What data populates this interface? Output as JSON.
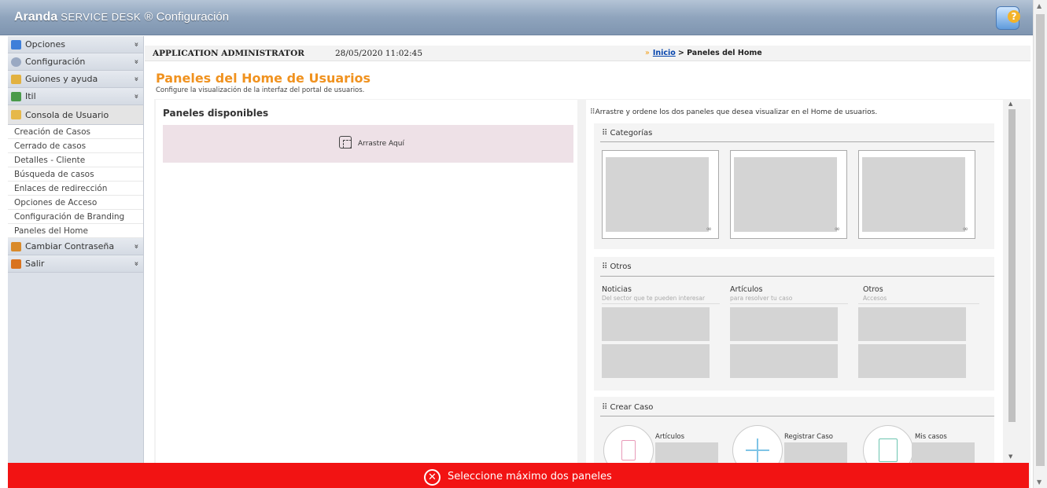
{
  "app": {
    "brand_name": "Aranda",
    "brand_product": "SERVICE DESK",
    "brand_mark": "®",
    "brand_section": "Configuración",
    "help_glyph": "?"
  },
  "sidebar": {
    "items": [
      {
        "label": "Opciones",
        "icon": "panel-icon",
        "color": "#3f7fd9",
        "chev": "»"
      },
      {
        "label": "Configuración",
        "icon": "gear-icon",
        "color": "#9aa9c2",
        "chev": "»"
      },
      {
        "label": "Guiones y ayuda",
        "icon": "script-icon",
        "color": "#e2b140",
        "chev": "»"
      },
      {
        "label": "Itil",
        "icon": "chart-icon",
        "color": "#4a9a4a",
        "chev": "»"
      },
      {
        "label": "Consola de Usuario",
        "icon": "folder-icon",
        "color": "#e6b84a"
      },
      {
        "label": "Cambiar Contraseña",
        "icon": "key-user-icon",
        "color": "#d98a2a",
        "chev": "»"
      },
      {
        "label": "Salir",
        "icon": "exit-user-icon",
        "color": "#d9731f",
        "chev": "»"
      }
    ],
    "subitems": [
      "Creación de Casos",
      "Cerrado de casos",
      "Detalles - Cliente",
      "Búsqueda de casos",
      "Enlaces de redirección",
      "Opciones de Acceso",
      "Configuración de Branding",
      "Paneles del Home"
    ]
  },
  "header": {
    "user": "APPLICATION ADMINISTRATOR",
    "datetime": "28/05/2020 11:02:45",
    "crumb_arrow": "»",
    "crumb_home": "Inicio",
    "crumb_current": "> Paneles del Home"
  },
  "page": {
    "title": "Paneles del Home de Usuarios",
    "subtitle": "Configure la visualización de la interfaz del portal de usuarios."
  },
  "available": {
    "title": "Paneles disponibles",
    "drop_label": "Arrastre Aquí"
  },
  "preview": {
    "hint": "Arrastre y ordene los dos paneles que desea visualizar en el Home de usuarios.",
    "grip": "⠿",
    "link_glyph": "∞",
    "categorias": {
      "title": "Categorías"
    },
    "otros": {
      "title": "Otros",
      "columns": [
        {
          "head": "Noticias",
          "sub": "Del sector que te pueden interesar"
        },
        {
          "head": "Artículos",
          "sub": "para resolver tu caso"
        },
        {
          "head": "Otros",
          "sub": "Accesos"
        }
      ]
    },
    "crear": {
      "title": "Crear Caso",
      "items": [
        "Artículos",
        "Registrar Caso",
        "Mis casos"
      ]
    }
  },
  "error": {
    "icon_glyph": "✕",
    "message": "Seleccione máximo dos paneles"
  }
}
